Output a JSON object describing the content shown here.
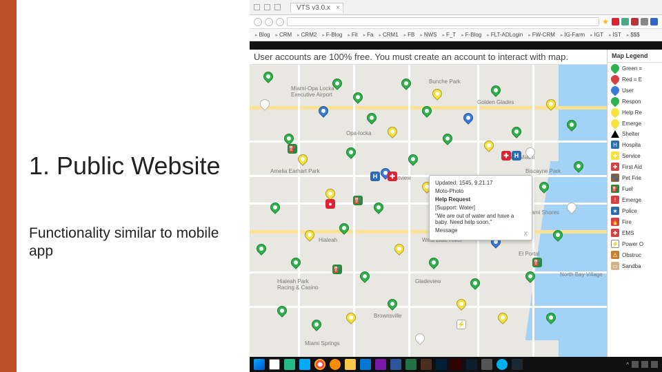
{
  "slide": {
    "title": "1. Public Website",
    "subtitle": "Functionality similar to mobile app"
  },
  "browser": {
    "tab_title": "VTS v3.0.x",
    "bookmarks": [
      "Blog",
      "CRM",
      "CRM2",
      "F-Blog",
      "Fit",
      "Fa",
      "CRM1",
      "FB",
      "NWS",
      "F_T",
      "F-Blog",
      "FLT-ADLogin",
      "FW-CRM",
      "IG-Farm",
      "IGT",
      "IST",
      "$$$"
    ]
  },
  "banner": "User accounts are 100% free. You must create an account to interact with map.",
  "places": {
    "opalocka_airport": "Miami-Opa Locka Executive Airport",
    "amelia": "Amelia Earhart Park",
    "opalocka": "Opa-locka",
    "bunche": "Bunche Park",
    "golden": "Golden Glades",
    "westview": "Westview",
    "biscayne": "Biscayne Park",
    "north_miami": "North Miami",
    "miami_shores": "Miami Shores",
    "el_portal": "El Portal",
    "hialeah": "Hialeah",
    "wlr": "West Little River",
    "gladeview": "Gladeview",
    "hialeah_park": "Hialeah Park Racing & Casino",
    "brownsville": "Brownsville",
    "miami_springs": "Miami Springs",
    "nbv": "North Bay Village"
  },
  "popup": {
    "updated": "Updated: 1545, 9.21.17",
    "moto": "Moto-Photo",
    "title": "Help Request",
    "support": "[Support: Water]",
    "body": "\"We are out of water and have a baby. Need help soon.\"",
    "message": "Message",
    "close": "X"
  },
  "legend": {
    "title": "Map Legend",
    "items": [
      {
        "color": "#2fb24c",
        "shape": "pin",
        "label": "Green ="
      },
      {
        "color": "#d64040",
        "shape": "pin",
        "label": "Red = E"
      },
      {
        "color": "#3a7bd5",
        "shape": "pin",
        "label": "User"
      },
      {
        "color": "#2fb24c",
        "shape": "pin",
        "label": "Respon"
      },
      {
        "color": "#f7e13b",
        "shape": "pin",
        "label": "Help Re"
      },
      {
        "color": "#f7e13b",
        "shape": "pin",
        "label": "Emerge"
      },
      {
        "color": "#000",
        "shape": "tri",
        "label": "Shelter"
      },
      {
        "color": "#2b6cb0",
        "shape": "sq",
        "glyph": "H",
        "label": "Hospita"
      },
      {
        "color": "#f7e13b",
        "shape": "sq",
        "glyph": "✚",
        "label": "Service"
      },
      {
        "color": "#d64040",
        "shape": "sq",
        "glyph": "✚",
        "label": "First Aid"
      },
      {
        "color": "#8b5e3c",
        "shape": "sq",
        "glyph": "🐾",
        "label": "Pet Frie"
      },
      {
        "color": "#1e8e3e",
        "shape": "sq",
        "glyph": "⛽",
        "label": "Fuel"
      },
      {
        "color": "#d64040",
        "shape": "sq",
        "glyph": "!",
        "label": "Emerge"
      },
      {
        "color": "#2b6cb0",
        "shape": "sq",
        "glyph": "★",
        "label": "Police"
      },
      {
        "color": "#d64040",
        "shape": "sq",
        "glyph": "🔥",
        "label": "Fire"
      },
      {
        "color": "#d64040",
        "shape": "sq",
        "glyph": "✚",
        "label": "EMS"
      },
      {
        "color": "#fff",
        "shape": "sq",
        "glyph": "⚡",
        "label": "Power O"
      },
      {
        "color": "#c97f2e",
        "shape": "sq",
        "glyph": "⚠",
        "label": "Obstruc"
      },
      {
        "color": "#d2b48c",
        "shape": "sq",
        "glyph": "▭",
        "label": "Sandba"
      }
    ]
  },
  "taskbar": {
    "time": ""
  }
}
